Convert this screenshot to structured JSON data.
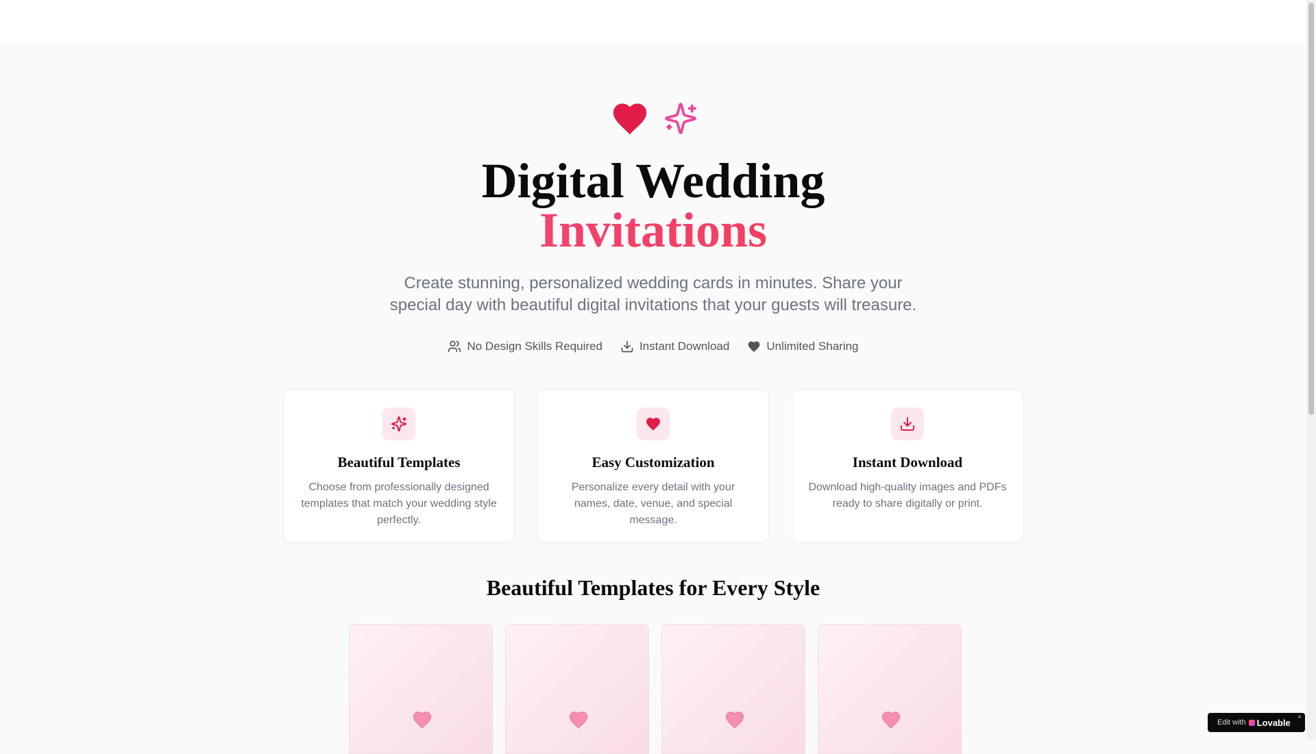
{
  "hero": {
    "title_line1": "Digital Wedding",
    "title_line2": "Invitations",
    "subtitle": "Create stunning, personalized wedding cards in minutes. Share your special day with beautiful digital invitations that your guests will treasure.",
    "icons": [
      "heart-icon",
      "sparkles-icon"
    ]
  },
  "features": [
    {
      "label": "No Design Skills Required",
      "icon": "users-icon"
    },
    {
      "label": "Instant Download",
      "icon": "download-icon"
    },
    {
      "label": "Unlimited Sharing",
      "icon": "heart-icon"
    }
  ],
  "cards": [
    {
      "title": "Beautiful Templates",
      "description": "Choose from professionally designed templates that match your wedding style perfectly.",
      "icon": "sparkles-icon"
    },
    {
      "title": "Easy Customization",
      "description": "Personalize every detail with your names, date, venue, and special message.",
      "icon": "heart-icon"
    },
    {
      "title": "Instant Download",
      "description": "Download high-quality images and PDFs ready to share digitally or print.",
      "icon": "download-icon"
    }
  ],
  "templates_section": {
    "title": "Beautiful Templates for Every Style",
    "template_icons": [
      "heart-icon",
      "heart-icon",
      "heart-icon",
      "heart-icon"
    ]
  },
  "badge": {
    "prefix": "Edit with",
    "brand": "Lovable",
    "close": "×"
  },
  "colors": {
    "accent": "#e11d48",
    "accent_soft": "#fce7ee",
    "gradient_start": "#ec4899",
    "gradient_end": "#e11d48",
    "template_heart": "#f48fb1"
  }
}
